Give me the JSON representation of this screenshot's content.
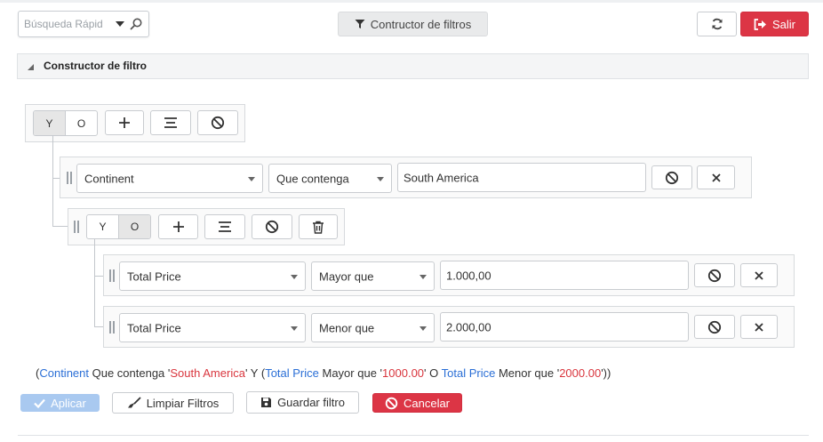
{
  "toolbar": {
    "search_placeholder": "Búsqueda Rápid",
    "filter_builder_label": "Contructor de filtros",
    "logout_label": "Salir"
  },
  "panel": {
    "title": "Constructor de filtro"
  },
  "root_group": {
    "conj_and": "Y",
    "conj_or": "O",
    "selected": "Y",
    "rule": {
      "field": "Continent",
      "operator": "Que contenga",
      "value": "South America"
    }
  },
  "sub_group": {
    "conj_and": "Y",
    "conj_or": "O",
    "selected": "O",
    "rules": [
      {
        "field": "Total Price",
        "operator": "Mayor que",
        "value": "1.000,00"
      },
      {
        "field": "Total Price",
        "operator": "Menor que",
        "value": "2.000,00"
      }
    ]
  },
  "summary": {
    "p1": "(",
    "f1": "Continent",
    "o1": " Que contenga '",
    "v1": "South America",
    "c1": "' Y (",
    "f2": "Total Price",
    "o2": " Mayor que '",
    "v2": "1000.00",
    "c2": "' O ",
    "f3": "Total Price",
    "o3": " Menor que '",
    "v3": "2000.00",
    "c3": "'))"
  },
  "actions": {
    "apply": "Aplicar",
    "clear": "Limpiar Filtros",
    "save": "Guardar filtro",
    "cancel": "Cancelar"
  },
  "colors": {
    "danger": "#dc3545",
    "link_blue": "#2b6fd6",
    "value_red": "#d9363e",
    "apply_disabled": "#a9c9f0"
  }
}
